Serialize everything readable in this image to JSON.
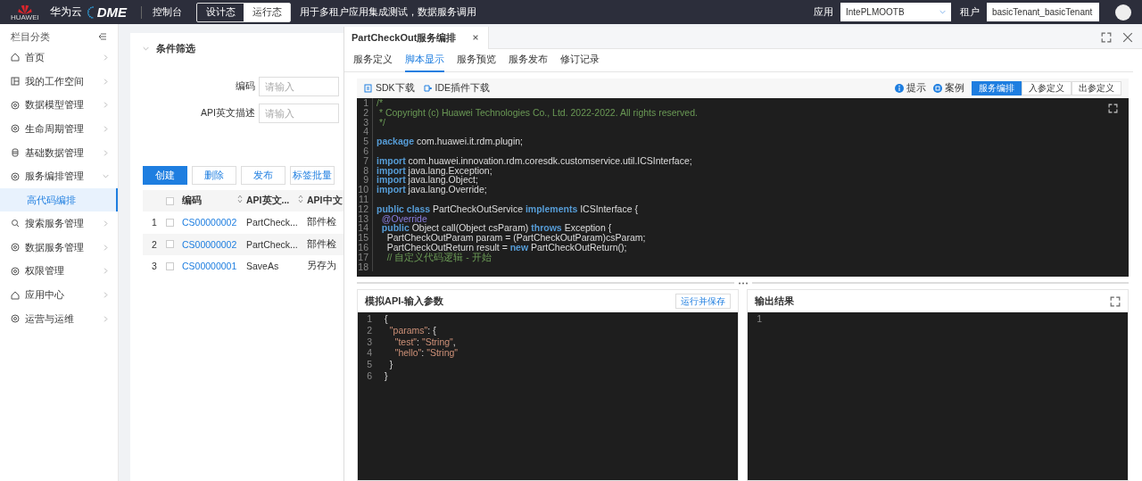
{
  "topbar": {
    "brand_caption": "HUAWEI",
    "cloud": "华为云",
    "product": "DME",
    "console": "控制台",
    "modes": [
      {
        "label": "设计态",
        "selected": false
      },
      {
        "label": "运行态",
        "selected": true
      }
    ],
    "description": "用于多租户应用集成测试，数据服务调用",
    "app_label": "应用",
    "app_value": "IntePLMOOTB",
    "tenant_label": "租户",
    "tenant_value": "basicTenant_basicTenant"
  },
  "sidebar": {
    "title": "栏目分类",
    "items": [
      {
        "label": "首页",
        "expanded": false
      },
      {
        "label": "我的工作空间",
        "expanded": false
      },
      {
        "label": "数据模型管理",
        "expanded": false
      },
      {
        "label": "生命周期管理",
        "expanded": false
      },
      {
        "label": "基础数据管理",
        "expanded": false
      },
      {
        "label": "服务编排管理",
        "expanded": true,
        "children": [
          {
            "label": "高代码编排",
            "selected": true
          }
        ]
      },
      {
        "label": "搜索服务管理",
        "expanded": false
      },
      {
        "label": "数据服务管理",
        "expanded": false
      },
      {
        "label": "权限管理",
        "expanded": false
      },
      {
        "label": "应用中心",
        "expanded": false
      },
      {
        "label": "运营与运维",
        "expanded": false
      }
    ]
  },
  "filter": {
    "title": "条件筛选",
    "fields": [
      {
        "label": "编码",
        "placeholder": "请输入"
      },
      {
        "label": "API英文描述",
        "placeholder": "请输入"
      }
    ],
    "buttons": [
      {
        "label": "创建",
        "kind": "primary"
      },
      {
        "label": "删除",
        "kind": "default"
      },
      {
        "label": "发布",
        "kind": "default"
      },
      {
        "label": "标签批量",
        "kind": "default"
      }
    ]
  },
  "table": {
    "header_checked": false,
    "columns": [
      {
        "label": "编码",
        "sortable": true
      },
      {
        "label": "API英文...",
        "sortable": true
      },
      {
        "label": "API中文",
        "sortable": false
      }
    ],
    "rows": [
      {
        "index": "1",
        "checked": false,
        "cells": [
          "CS00000002",
          "PartCheck...",
          "部件检"
        ]
      },
      {
        "index": "2",
        "checked": false,
        "cells": [
          "CS00000002",
          "PartCheck...",
          "部件检"
        ]
      },
      {
        "index": "3",
        "checked": false,
        "cells": [
          "CS00000001",
          "SaveAs",
          "另存为"
        ]
      }
    ]
  },
  "drawer": {
    "title": "PartCheckOut服务编排",
    "tabs": [
      {
        "label": "服务定义",
        "selected": false
      },
      {
        "label": "脚本显示",
        "selected": true
      },
      {
        "label": "服务预览",
        "selected": false
      },
      {
        "label": "服务发布",
        "selected": false
      },
      {
        "label": "修订记录",
        "selected": false
      }
    ],
    "tools": [
      "SDK下载",
      "IDE插件下载"
    ],
    "hint": "提示",
    "example": "案例",
    "modes": [
      {
        "label": "服务编排",
        "selected": true
      },
      {
        "label": "入参定义",
        "selected": false
      },
      {
        "label": "出参定义",
        "selected": false
      }
    ],
    "code": [
      {
        "number": "1",
        "tokens": [
          {
            "kind": "comment",
            "text": "/*"
          }
        ]
      },
      {
        "number": "2",
        "tokens": [
          {
            "kind": "comment",
            "text": " * Copyright (c) Huawei Technologies Co., Ltd. 2022-2022. All rights reserved."
          }
        ]
      },
      {
        "number": "3",
        "tokens": [
          {
            "kind": "comment",
            "text": " */"
          }
        ]
      },
      {
        "number": "4"
      },
      {
        "number": "5",
        "tokens": [
          {
            "kind": "keyword",
            "text": "package"
          },
          {
            "kind": "plain",
            "text": " com.huawei.it.rdm.plugin;"
          }
        ]
      },
      {
        "number": "6"
      },
      {
        "number": "7",
        "tokens": [
          {
            "kind": "keyword",
            "text": "import"
          },
          {
            "kind": "plain",
            "text": " com.huawei.innovation.rdm.coresdk.customservice.util.ICSInterface;"
          }
        ]
      },
      {
        "number": "8",
        "tokens": [
          {
            "kind": "keyword",
            "text": "import"
          },
          {
            "kind": "plain",
            "text": " java.lang.Exception;"
          }
        ]
      },
      {
        "number": "9",
        "tokens": [
          {
            "kind": "keyword",
            "text": "import"
          },
          {
            "kind": "plain",
            "text": " java.lang.Object;"
          }
        ]
      },
      {
        "number": "10",
        "tokens": [
          {
            "kind": "keyword",
            "text": "import"
          },
          {
            "kind": "plain",
            "text": " java.lang.Override;"
          }
        ]
      },
      {
        "number": "11"
      },
      {
        "number": "12",
        "tokens": [
          {
            "kind": "keyword",
            "text": "public class"
          },
          {
            "kind": "plain",
            "text": " PartCheckOutService "
          },
          {
            "kind": "keyword",
            "text": "implements"
          },
          {
            "kind": "plain",
            "text": " ICSInterface {"
          }
        ]
      },
      {
        "number": "13",
        "tokens": [
          {
            "kind": "annotation",
            "text": "  @Override"
          }
        ]
      },
      {
        "number": "14",
        "tokens": [
          {
            "kind": "keyword",
            "text": "  public"
          },
          {
            "kind": "plain",
            "text": " Object call(Object csParam) "
          },
          {
            "kind": "keyword",
            "text": "throws"
          },
          {
            "kind": "plain",
            "text": " Exception {"
          }
        ]
      },
      {
        "number": "15",
        "tokens": [
          {
            "kind": "plain",
            "text": "    PartCheckOutParam param = (PartCheckOutParam)csParam;"
          }
        ]
      },
      {
        "number": "16",
        "tokens": [
          {
            "kind": "plain",
            "text": "    PartCheckOutReturn result = "
          },
          {
            "kind": "keyword",
            "text": "new"
          },
          {
            "kind": "plain",
            "text": " PartCheckOutReturn();"
          }
        ]
      },
      {
        "number": "17",
        "tokens": [
          {
            "kind": "comment",
            "text": "    // 自定义代码逻辑 - 开始"
          }
        ]
      },
      {
        "number": "18"
      }
    ],
    "input_panel": {
      "title": "模拟API-输入参数",
      "action": "运行并保存",
      "code": [
        {
          "number": "1",
          "tokens": [
            {
              "kind": "plain",
              "text": "{"
            }
          ]
        },
        {
          "number": "2",
          "tokens": [
            {
              "kind": "string",
              "text": "  \"params\""
            },
            {
              "kind": "plain",
              "text": ": {"
            }
          ]
        },
        {
          "number": "3",
          "tokens": [
            {
              "kind": "string",
              "text": "    \"test\""
            },
            {
              "kind": "plain",
              "text": ": "
            },
            {
              "kind": "string",
              "text": "\"String\""
            },
            {
              "kind": "plain",
              "text": ","
            }
          ]
        },
        {
          "number": "4",
          "tokens": [
            {
              "kind": "string",
              "text": "    \"hello\""
            },
            {
              "kind": "plain",
              "text": ": "
            },
            {
              "kind": "string",
              "text": "\"String\""
            }
          ]
        },
        {
          "number": "5",
          "tokens": [
            {
              "kind": "plain",
              "text": "  }"
            }
          ]
        },
        {
          "number": "6",
          "tokens": [
            {
              "kind": "plain",
              "text": "}"
            }
          ]
        }
      ]
    },
    "output_panel": {
      "title": "输出结果",
      "code": [
        {
          "number": "1"
        }
      ]
    }
  }
}
